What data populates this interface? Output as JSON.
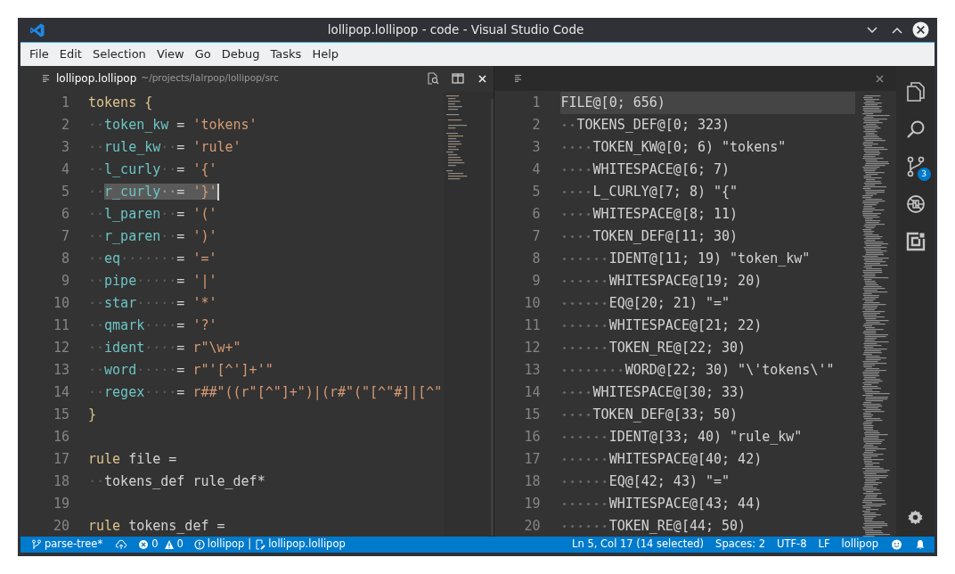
{
  "window": {
    "title": "lollipop.lollipop - code - Visual Studio Code"
  },
  "menu": [
    "File",
    "Edit",
    "Selection",
    "View",
    "Go",
    "Debug",
    "Tasks",
    "Help"
  ],
  "left_editor": {
    "tab": {
      "title": "lollipop.lollipop",
      "path": "~/projects/lalrpop/lollipop/src"
    },
    "lines": [
      {
        "number": "1",
        "selected": false,
        "segments": [
          {
            "text": "tokens {",
            "kind": "keyword"
          }
        ]
      },
      {
        "number": "2",
        "selected": false,
        "segments": [
          {
            "text": "··",
            "kind": "ws"
          },
          {
            "text": "token_kw",
            "kind": "name"
          },
          {
            "text": " = ",
            "kind": "plain"
          },
          {
            "text": "'tokens'",
            "kind": "string"
          }
        ]
      },
      {
        "number": "3",
        "selected": false,
        "segments": [
          {
            "text": "··",
            "kind": "ws"
          },
          {
            "text": "rule_kw",
            "kind": "name"
          },
          {
            "text": "··",
            "kind": "ws"
          },
          {
            "text": "= ",
            "kind": "plain"
          },
          {
            "text": "'rule'",
            "kind": "string"
          }
        ]
      },
      {
        "number": "4",
        "selected": false,
        "segments": [
          {
            "text": "··",
            "kind": "ws"
          },
          {
            "text": "l_curly",
            "kind": "name"
          },
          {
            "text": "··",
            "kind": "ws"
          },
          {
            "text": "= ",
            "kind": "plain"
          },
          {
            "text": "'{'",
            "kind": "string"
          }
        ]
      },
      {
        "number": "5",
        "selected": true,
        "segments": [
          {
            "text": "··",
            "kind": "ws"
          },
          {
            "text": "r_curly",
            "kind": "name"
          },
          {
            "text": "··",
            "kind": "ws"
          },
          {
            "text": "= ",
            "kind": "plain"
          },
          {
            "text": "'}'",
            "kind": "string"
          }
        ]
      },
      {
        "number": "6",
        "selected": false,
        "segments": [
          {
            "text": "··",
            "kind": "ws"
          },
          {
            "text": "l_paren",
            "kind": "name"
          },
          {
            "text": "··",
            "kind": "ws"
          },
          {
            "text": "= ",
            "kind": "plain"
          },
          {
            "text": "'('",
            "kind": "string"
          }
        ]
      },
      {
        "number": "7",
        "selected": false,
        "segments": [
          {
            "text": "··",
            "kind": "ws"
          },
          {
            "text": "r_paren",
            "kind": "name"
          },
          {
            "text": "··",
            "kind": "ws"
          },
          {
            "text": "= ",
            "kind": "plain"
          },
          {
            "text": "')'",
            "kind": "string"
          }
        ]
      },
      {
        "number": "8",
        "selected": false,
        "segments": [
          {
            "text": "··",
            "kind": "ws"
          },
          {
            "text": "eq",
            "kind": "name"
          },
          {
            "text": "·······",
            "kind": "ws"
          },
          {
            "text": "= ",
            "kind": "plain"
          },
          {
            "text": "'='",
            "kind": "string"
          }
        ]
      },
      {
        "number": "9",
        "selected": false,
        "segments": [
          {
            "text": "··",
            "kind": "ws"
          },
          {
            "text": "pipe",
            "kind": "name"
          },
          {
            "text": "·····",
            "kind": "ws"
          },
          {
            "text": "= ",
            "kind": "plain"
          },
          {
            "text": "'|'",
            "kind": "string"
          }
        ]
      },
      {
        "number": "10",
        "selected": false,
        "segments": [
          {
            "text": "··",
            "kind": "ws"
          },
          {
            "text": "star",
            "kind": "name"
          },
          {
            "text": "·····",
            "kind": "ws"
          },
          {
            "text": "= ",
            "kind": "plain"
          },
          {
            "text": "'*'",
            "kind": "string"
          }
        ]
      },
      {
        "number": "11",
        "selected": false,
        "segments": [
          {
            "text": "··",
            "kind": "ws"
          },
          {
            "text": "qmark",
            "kind": "name"
          },
          {
            "text": "····",
            "kind": "ws"
          },
          {
            "text": "= ",
            "kind": "plain"
          },
          {
            "text": "'?'",
            "kind": "string"
          }
        ]
      },
      {
        "number": "12",
        "selected": false,
        "segments": [
          {
            "text": "··",
            "kind": "ws"
          },
          {
            "text": "ident",
            "kind": "name"
          },
          {
            "text": "····",
            "kind": "ws"
          },
          {
            "text": "= ",
            "kind": "plain"
          },
          {
            "text": "r\"\\w+\"",
            "kind": "string"
          }
        ]
      },
      {
        "number": "13",
        "selected": false,
        "segments": [
          {
            "text": "··",
            "kind": "ws"
          },
          {
            "text": "word",
            "kind": "name"
          },
          {
            "text": "·····",
            "kind": "ws"
          },
          {
            "text": "= ",
            "kind": "plain"
          },
          {
            "text": "r\"'[^']+'\"",
            "kind": "string"
          }
        ]
      },
      {
        "number": "14",
        "selected": false,
        "segments": [
          {
            "text": "··",
            "kind": "ws"
          },
          {
            "text": "regex",
            "kind": "name"
          },
          {
            "text": "····",
            "kind": "ws"
          },
          {
            "text": "= ",
            "kind": "plain"
          },
          {
            "text": "r##\"((r\"[^\"]+\")|(r#\"(\"[^\"#]|[^\"",
            "kind": "string"
          }
        ]
      },
      {
        "number": "15",
        "selected": false,
        "segments": [
          {
            "text": "}",
            "kind": "keyword"
          }
        ]
      },
      {
        "number": "16",
        "selected": false
      },
      {
        "number": "17",
        "selected": false,
        "segments": [
          {
            "text": "rule",
            "kind": "keyword"
          },
          {
            "text": " file =",
            "kind": "plain"
          }
        ]
      },
      {
        "number": "18",
        "selected": false,
        "segments": [
          {
            "text": "··",
            "kind": "ws"
          },
          {
            "text": "tokens_def rule_def*",
            "kind": "plain"
          }
        ]
      },
      {
        "number": "19",
        "selected": false
      },
      {
        "number": "20",
        "selected": false,
        "segments": [
          {
            "text": "rule",
            "kind": "keyword"
          },
          {
            "text": " tokens_def =",
            "kind": "plain"
          }
        ]
      }
    ]
  },
  "right_editor": {
    "tree": [
      {
        "number": "1",
        "text": "FILE@[0; 656)",
        "current": true,
        "children": [
          {
            "number": "2",
            "text": "TOKENS_DEF@[0; 323)",
            "current": false,
            "children": [
              {
                "number": "3",
                "text": "TOKEN_KW@[0; 6) \"tokens\"",
                "current": false
              },
              {
                "number": "4",
                "text": "WHITESPACE@[6; 7)",
                "current": false
              },
              {
                "number": "5",
                "text": "L_CURLY@[7; 8) \"{\"",
                "current": false
              },
              {
                "number": "6",
                "text": "WHITESPACE@[8; 11)",
                "current": false
              },
              {
                "number": "7",
                "text": "TOKEN_DEF@[11; 30)",
                "current": false,
                "children": [
                  {
                    "number": "8",
                    "text": "IDENT@[11; 19) \"token_kw\"",
                    "current": false
                  },
                  {
                    "number": "9",
                    "text": "WHITESPACE@[19; 20)",
                    "current": false
                  },
                  {
                    "number": "10",
                    "text": "EQ@[20; 21) \"=\"",
                    "current": false
                  },
                  {
                    "number": "11",
                    "text": "WHITESPACE@[21; 22)",
                    "current": false
                  },
                  {
                    "number": "12",
                    "text": "TOKEN_RE@[22; 30)",
                    "current": false,
                    "children": [
                      {
                        "number": "13",
                        "text": "WORD@[22; 30) \"\\'tokens\\'\"",
                        "current": false
                      }
                    ]
                  }
                ]
              },
              {
                "number": "14",
                "text": "WHITESPACE@[30; 33)",
                "current": false
              },
              {
                "number": "15",
                "text": "TOKEN_DEF@[33; 50)",
                "current": false,
                "children": [
                  {
                    "number": "16",
                    "text": "IDENT@[33; 40) \"rule_kw\"",
                    "current": false
                  },
                  {
                    "number": "17",
                    "text": "WHITESPACE@[40; 42)",
                    "current": false
                  },
                  {
                    "number": "18",
                    "text": "EQ@[42; 43) \"=\"",
                    "current": false
                  },
                  {
                    "number": "19",
                    "text": "WHITESPACE@[43; 44)",
                    "current": false
                  },
                  {
                    "number": "20",
                    "text": "TOKEN_RE@[44; 50)",
                    "current": false
                  }
                ]
              }
            ]
          }
        ]
      }
    ]
  },
  "activity_bar": {
    "source_control_badge": "3"
  },
  "status_bar": {
    "branch": "parse-tree*",
    "errors": "0",
    "warnings": "0",
    "project": "lollipop",
    "separator": "|",
    "file": "lollipop.lollipop",
    "position": "Ln 5, Col 17 (14 selected)",
    "indentation": "Spaces: 2",
    "encoding": "UTF-8",
    "line_ending": "LF",
    "language": "lollipop"
  }
}
